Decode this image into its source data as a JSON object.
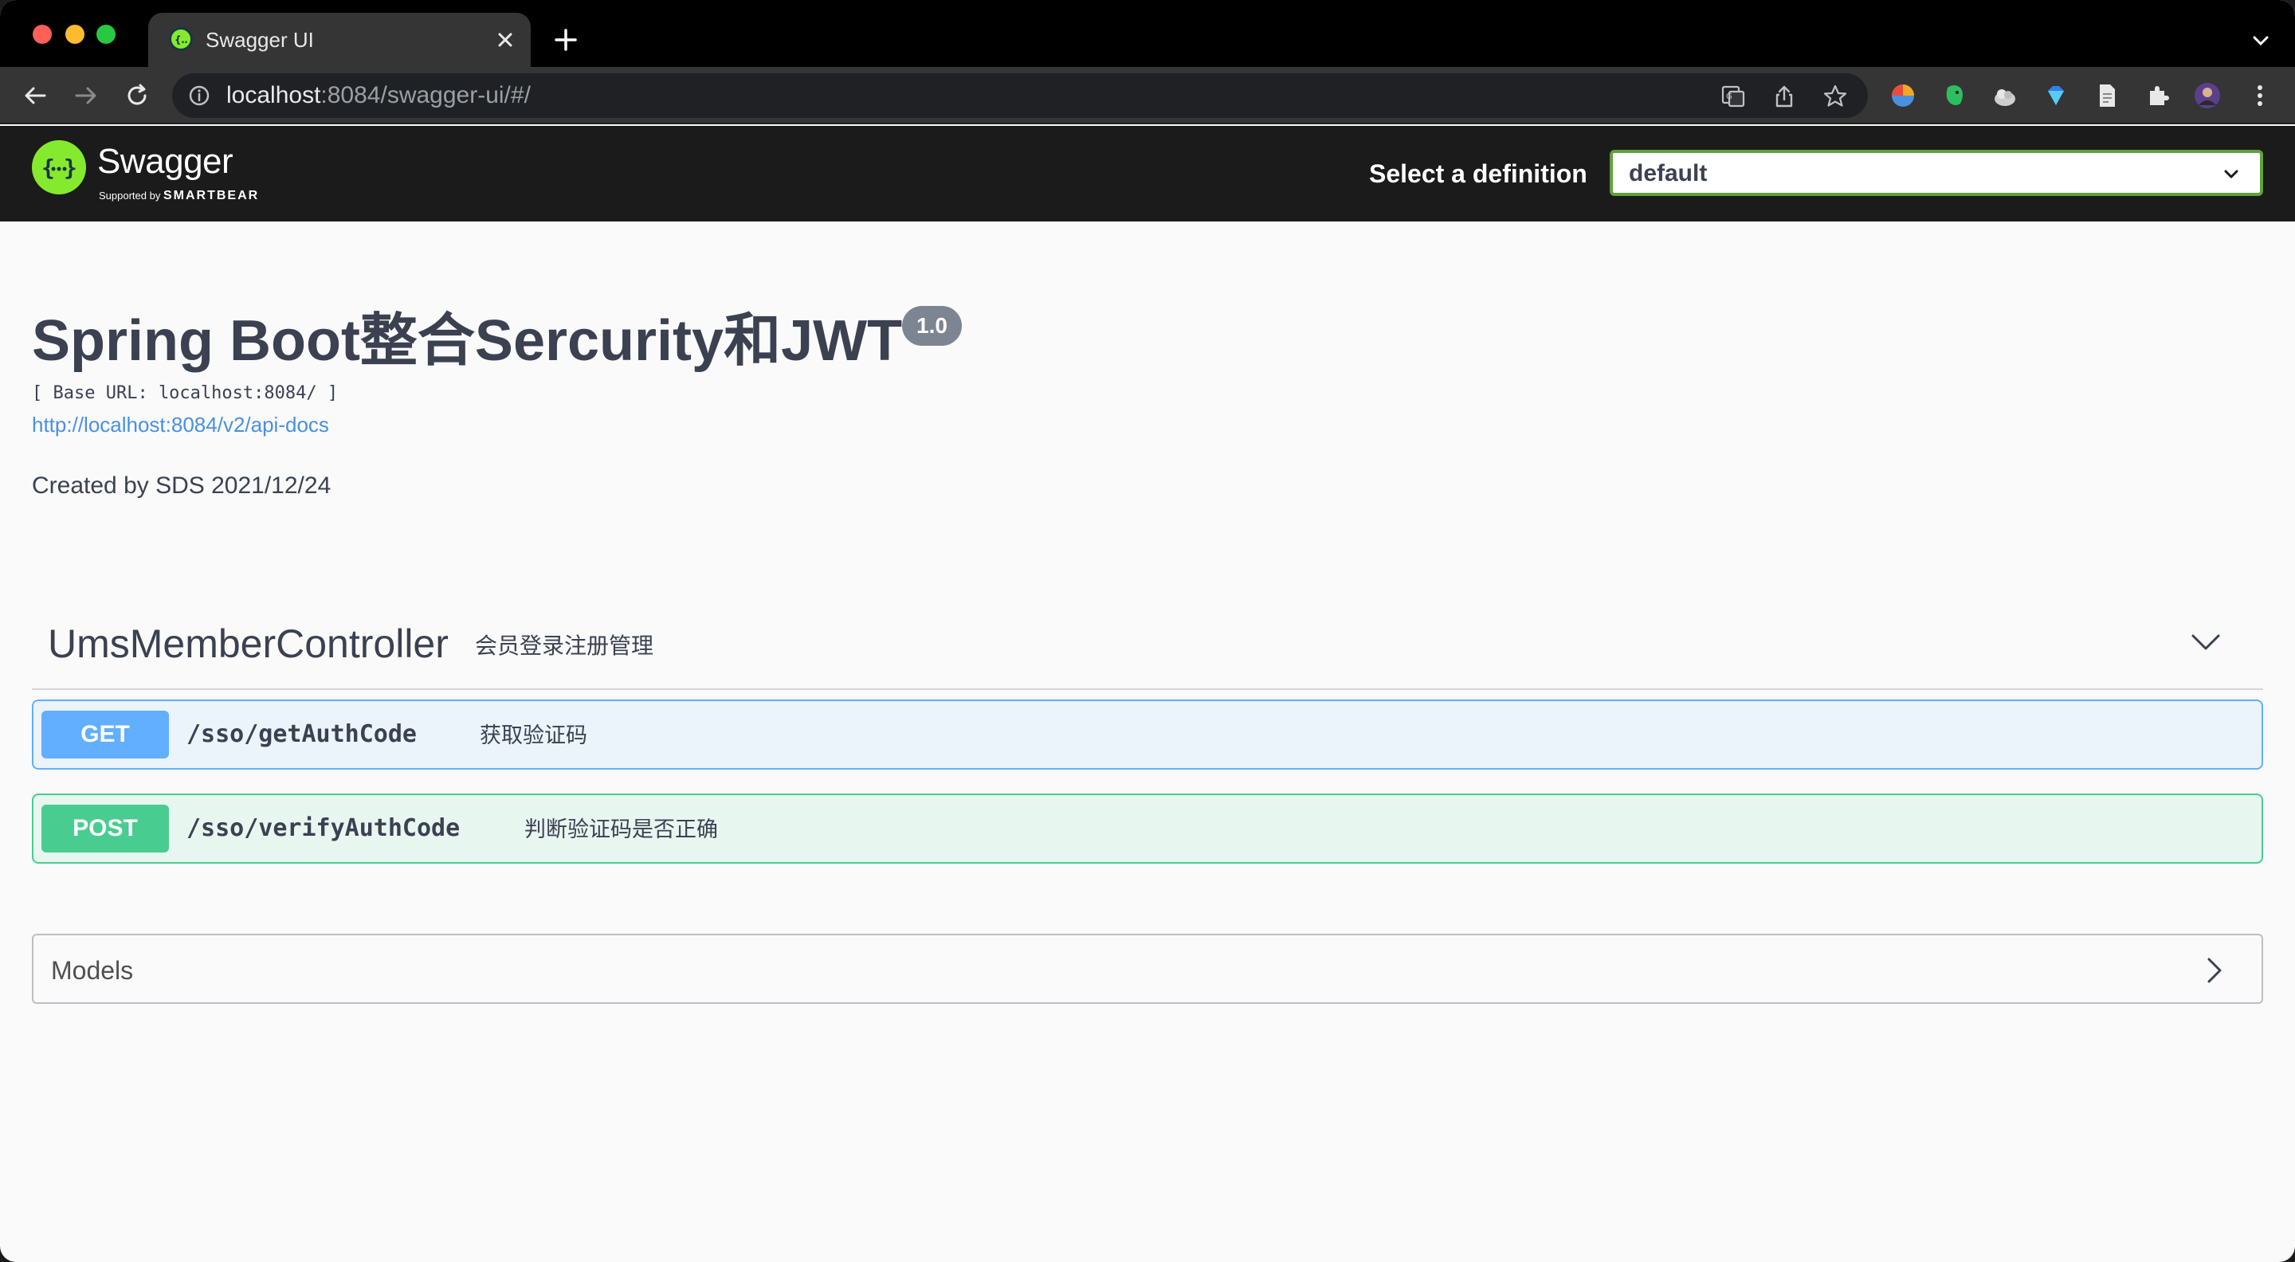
{
  "browser": {
    "tab_title": "Swagger UI",
    "url_host": "localhost",
    "url_rest": ":8084/swagger-ui/#/"
  },
  "topbar": {
    "logo_text": "Swagger",
    "logo_supported": "Supported by",
    "logo_brand": "SMARTBEAR",
    "definition_label": "Select a definition",
    "definition_value": "default"
  },
  "info": {
    "title": "Spring Boot整合Sercurity和JWT",
    "version": "1.0",
    "base_url": "[ Base URL: localhost:8084/ ]",
    "docs_link": "http://localhost:8084/v2/api-docs",
    "description": "Created by SDS 2021/12/24"
  },
  "tag": {
    "name": "UmsMemberController",
    "description": "会员登录注册管理"
  },
  "operations": [
    {
      "method": "GET",
      "path": "/sso/getAuthCode",
      "summary": "获取验证码"
    },
    {
      "method": "POST",
      "path": "/sso/verifyAuthCode",
      "summary": "判断验证码是否正确"
    }
  ],
  "models": {
    "label": "Models"
  },
  "colors": {
    "get": "#61affe",
    "post": "#49cc90",
    "swagger_green": "#85ea2d",
    "text": "#3b4151"
  }
}
